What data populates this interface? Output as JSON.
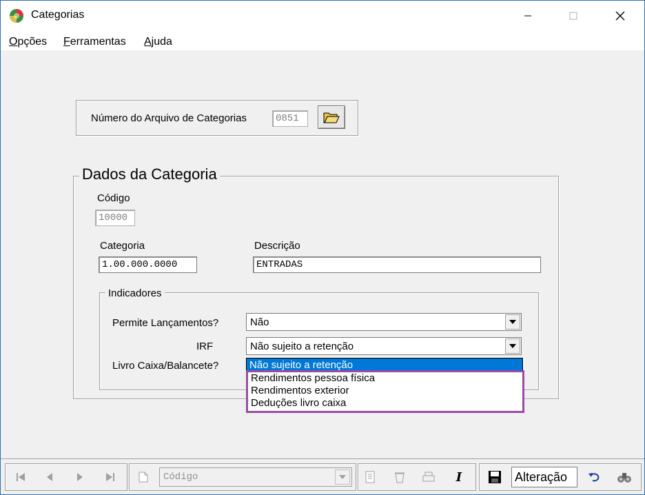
{
  "window": {
    "title": "Categorias",
    "icon": "globe-icon"
  },
  "menu": {
    "items": [
      {
        "first": "O",
        "rest": "pções"
      },
      {
        "first": "F",
        "rest": "erramentas"
      },
      {
        "first": "A",
        "rest": "juda"
      }
    ]
  },
  "file_section": {
    "label": "Número do Arquivo de Categorias",
    "value": "0851",
    "open_icon": "folder-open-icon"
  },
  "dados": {
    "title": "Dados da Categoria",
    "codigo_label": "Código",
    "codigo_value": "10000",
    "categoria_label": "Categoria",
    "categoria_value": "1.00.000.0000",
    "descricao_label": "Descrição",
    "descricao_value": "ENTRADAS"
  },
  "indicadores": {
    "title": "Indicadores",
    "permite_label": "Permite Lançamentos?",
    "permite_value": "Não",
    "irf_label": "IRF",
    "irf_value": "Não sujeito a retenção",
    "livro_label": "Livro Caixa/Balancete?"
  },
  "dropdown": {
    "options": [
      "Não sujeito a retenção",
      "Rendimentos pessoa física",
      "Rendimentos exterior",
      "Deduções livro caixa"
    ],
    "selected": "Não sujeito a retenção"
  },
  "toolbar": {
    "search_field_value": "Código",
    "status": "Alteração",
    "italic_label": "I"
  },
  "colors": {
    "selection": "#0078d7",
    "highlight_border": "#9b4aa8"
  }
}
